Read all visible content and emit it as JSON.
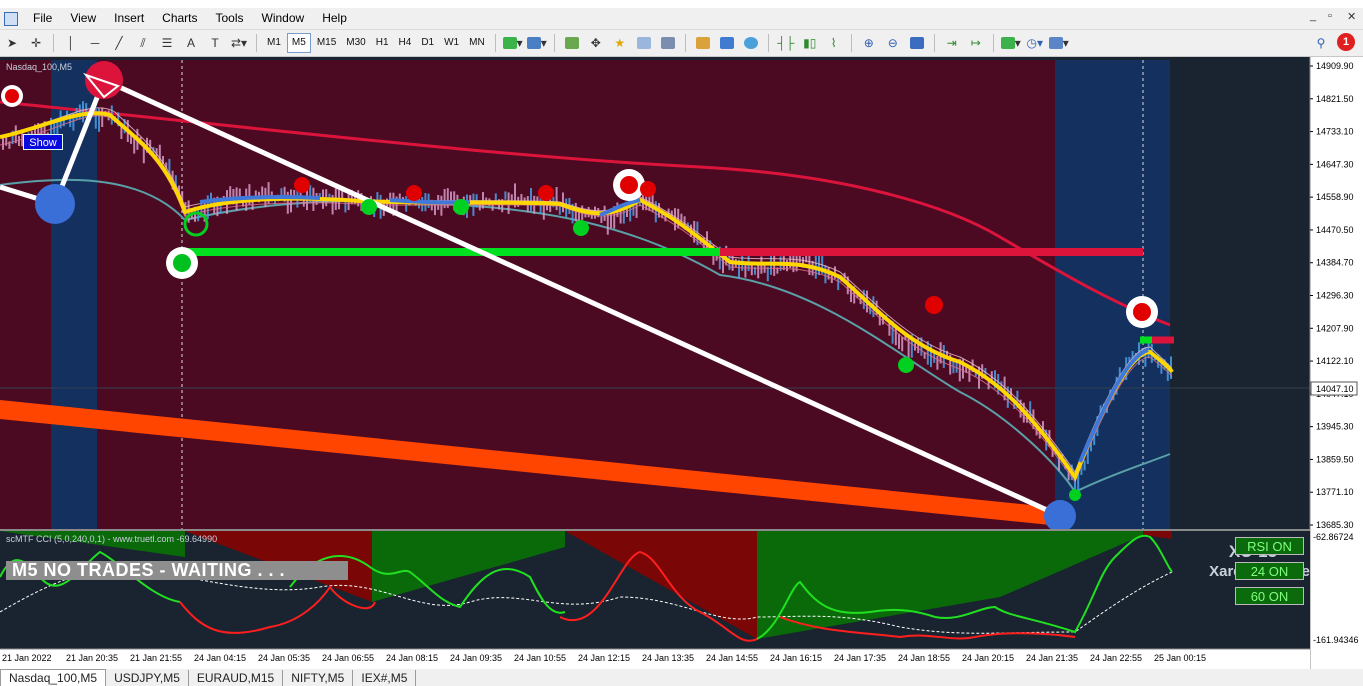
{
  "menu": [
    "File",
    "View",
    "Insert",
    "Charts",
    "Tools",
    "Window",
    "Help"
  ],
  "window_controls": [
    "_",
    "▫",
    "✕"
  ],
  "toolbar": {
    "timeframes": [
      "M1",
      "M5",
      "M15",
      "M30",
      "H1",
      "H4",
      "D1",
      "W1",
      "MN"
    ],
    "active_timeframe": "M5",
    "notification_count": "1"
  },
  "chart": {
    "symbol_label": "Nasdaq_100,M5",
    "show_button": "Show",
    "status_banner": "M5  NO TRADES - WAITING . . .",
    "brand_line1": "XU-13",
    "brand_line2": "Xard Universe",
    "price_ticks": [
      "14909.90",
      "14821.50",
      "14733.10",
      "14647.30",
      "14558.90",
      "14470.50",
      "14384.70",
      "14296.30",
      "14207.90",
      "14122.10",
      "14047.10",
      "13945.30",
      "13859.50",
      "13771.10",
      "13685.30"
    ],
    "current_price": "14047.10",
    "time_ticks": [
      "21 Jan 2022",
      "21 Jan 20:35",
      "21 Jan 21:55",
      "24 Jan 04:15",
      "24 Jan 05:35",
      "24 Jan 06:55",
      "24 Jan 08:15",
      "24 Jan 09:35",
      "24 Jan 10:55",
      "24 Jan 12:15",
      "24 Jan 13:35",
      "24 Jan 14:55",
      "24 Jan 16:15",
      "24 Jan 17:35",
      "24 Jan 18:55",
      "24 Jan 20:15",
      "24 Jan 21:35",
      "24 Jan 22:55",
      "25 Jan 00:15"
    ]
  },
  "indicator": {
    "label": "scMTF CCI (5,0,240,0,1) - www.truetl.com -69.64990",
    "scale_top": "-62.86724",
    "scale_bottom": "-161.94346",
    "buttons": [
      "RSI ON",
      "24 ON",
      "60 ON"
    ]
  },
  "tabs": [
    "Nasdaq_100,M5",
    "USDJPY,M5",
    "EURAUD,M15",
    "NIFTY,M5",
    "IEX#,M5"
  ],
  "active_tab": "Nasdaq_100,M5",
  "colors": {
    "bear_zone": "#4c0a22",
    "bull_zone": "#13305e",
    "trend_orange": "#ff4500",
    "support_green": "#00e020",
    "resistance_red": "#dc143c",
    "fast_ma": "#ffd700",
    "slow_ma": "#dc143c"
  }
}
